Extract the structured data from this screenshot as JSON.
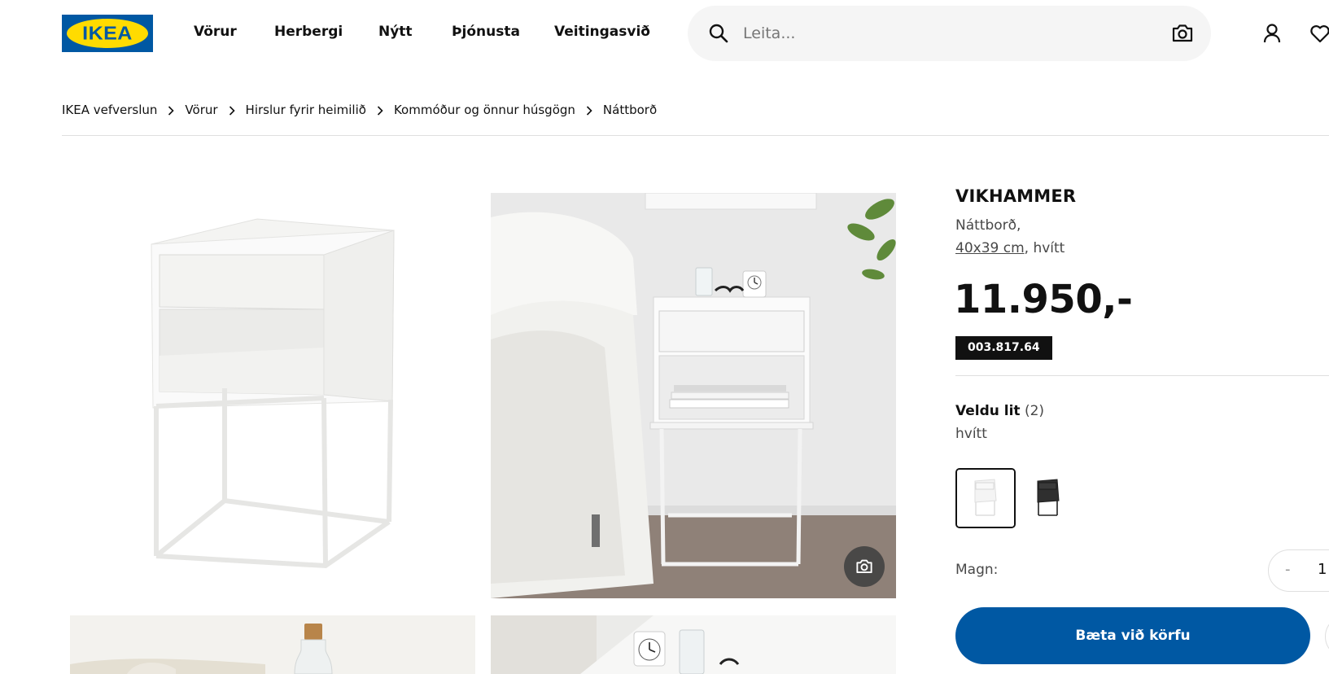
{
  "logo": {
    "text": "IKEA"
  },
  "nav": {
    "items": [
      {
        "label": "Vörur"
      },
      {
        "label": "Herbergi"
      },
      {
        "label": "Nýtt"
      },
      {
        "label": "Þjónusta"
      },
      {
        "label": "Veitingasvið"
      }
    ]
  },
  "search": {
    "placeholder": "Leita..."
  },
  "breadcrumb": [
    {
      "label": "IKEA vefverslun"
    },
    {
      "label": "Vörur"
    },
    {
      "label": "Hirslur fyrir heimilið"
    },
    {
      "label": "Kommóður og önnur húsgögn"
    },
    {
      "label": "Náttborð"
    }
  ],
  "product": {
    "name": "VIKHAMMER",
    "type": "Náttborð,",
    "dimensions": "40x39 cm",
    "color_suffix": ", hvítt",
    "price": "11.950,-",
    "article_number": "003.817.64"
  },
  "color": {
    "heading": "Veldu lit",
    "count": "(2)",
    "selected": "hvítt"
  },
  "quantity": {
    "label": "Magn:",
    "minus": "-",
    "value": "1"
  },
  "actions": {
    "add_to_cart": "Bæta við körfu"
  },
  "colors": {
    "brand_blue": "#0058a3",
    "brand_yellow": "#ffdb00",
    "badge_black": "#111111"
  }
}
